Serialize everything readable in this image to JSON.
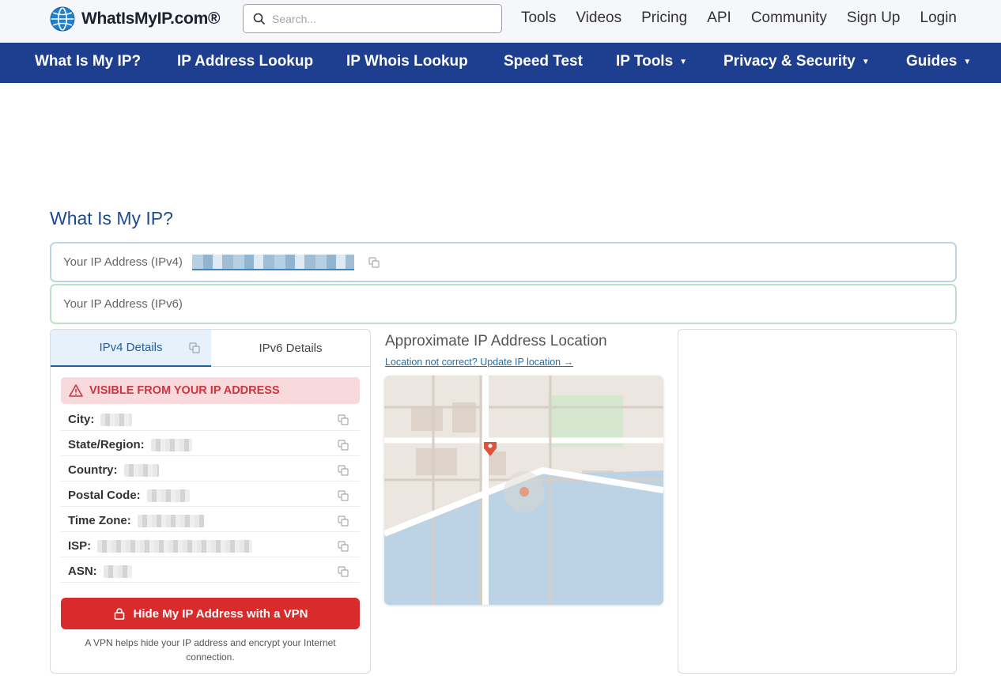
{
  "brand": {
    "name": "WhatIsMyIP.com®"
  },
  "search": {
    "placeholder": "Search..."
  },
  "top_links": [
    "Tools",
    "Videos",
    "Pricing",
    "API",
    "Community",
    "Sign Up",
    "Login"
  ],
  "nav": [
    {
      "label": "What Is My IP?",
      "caret": false
    },
    {
      "label": "IP Address Lookup",
      "caret": false
    },
    {
      "label": "IP Whois Lookup",
      "caret": false
    },
    {
      "label": "Speed Test",
      "caret": false
    },
    {
      "label": "IP Tools",
      "caret": true
    },
    {
      "label": "Privacy & Security",
      "caret": true
    },
    {
      "label": "Guides",
      "caret": true
    }
  ],
  "page_title": "What Is My IP?",
  "ipv4_label": "Your IP Address (IPv4)",
  "ipv6_label": "Your IP Address (IPv6)",
  "tabs": {
    "ipv4": "IPv4 Details",
    "ipv6": "IPv6 Details"
  },
  "visible_banner": "VISIBLE FROM YOUR IP ADDRESS",
  "details": [
    {
      "label": "City:"
    },
    {
      "label": "State/Region:"
    },
    {
      "label": "Country:"
    },
    {
      "label": "Postal Code:"
    },
    {
      "label": "Time Zone:"
    },
    {
      "label": "ISP:"
    },
    {
      "label": "ASN:"
    }
  ],
  "vpn_button": "Hide My IP Address with a VPN",
  "vpn_note": "A VPN helps hide your IP address and encrypt your Internet connection.",
  "location_title": "Approximate IP Address Location",
  "location_link": "Location not correct? Update IP location →",
  "colors": {
    "nav_bg": "#1e3f8f",
    "accent_red": "#d92b2b",
    "link_blue": "#1e6fb0",
    "title_blue": "#1e4b8f"
  },
  "icons": [
    "globe-logo-icon",
    "search-icon",
    "copy-icon",
    "warning-icon",
    "lock-icon",
    "map-pin-icon"
  ]
}
